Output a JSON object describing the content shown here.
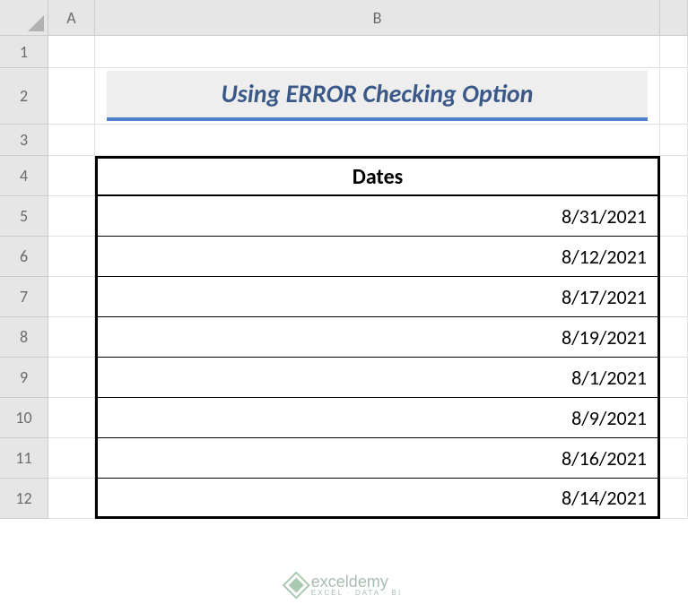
{
  "columns": {
    "A": "A",
    "B": "B"
  },
  "rows": [
    "1",
    "2",
    "3",
    "4",
    "5",
    "6",
    "7",
    "8",
    "9",
    "10",
    "11",
    "12"
  ],
  "title": "Using ERROR Checking Option",
  "table": {
    "header": "Dates",
    "data": [
      "8/31/2021",
      "8/12/2021",
      "8/17/2021",
      "8/19/2021",
      "8/1/2021",
      "8/9/2021",
      "8/16/2021",
      "8/14/2021"
    ]
  },
  "watermark": {
    "main": "exceldemy",
    "sub": "EXCEL · DATA · BI"
  },
  "chart_data": {
    "type": "table",
    "title": "Using ERROR Checking Option",
    "columns": [
      "Dates"
    ],
    "rows": [
      [
        "8/31/2021"
      ],
      [
        "8/12/2021"
      ],
      [
        "8/17/2021"
      ],
      [
        "8/19/2021"
      ],
      [
        "8/1/2021"
      ],
      [
        "8/9/2021"
      ],
      [
        "8/16/2021"
      ],
      [
        "8/14/2021"
      ]
    ]
  }
}
